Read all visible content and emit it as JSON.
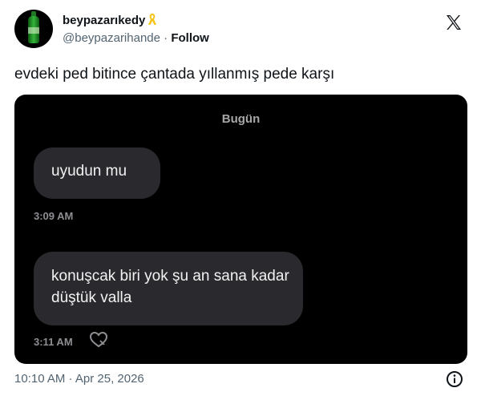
{
  "tweet": {
    "display_name": "beypazarıkedy",
    "handle": "@beypazarihande",
    "separator": "·",
    "follow_label": "Follow",
    "text": "evdeki ped bitince çantada yıllanmış pede karşı",
    "timestamp": "10:10 AM · Apr 25, 2026"
  },
  "media": {
    "date_header": "Bugün",
    "messages": [
      {
        "text": "uyudun mu",
        "time": "3:09 AM"
      },
      {
        "text": "konuşcak biri yok şu an sana kadar düştük valla",
        "time": "3:11 AM"
      }
    ]
  },
  "icons": {
    "x_logo": "x-logo-icon",
    "ribbon": "yellow-ribbon-icon",
    "info": "info-icon",
    "heart": "heart-reaction-icon"
  },
  "colors": {
    "ribbon": "#f5c518",
    "text": "#0f1419",
    "muted": "#536471",
    "bubble": "#2a2a2e"
  }
}
